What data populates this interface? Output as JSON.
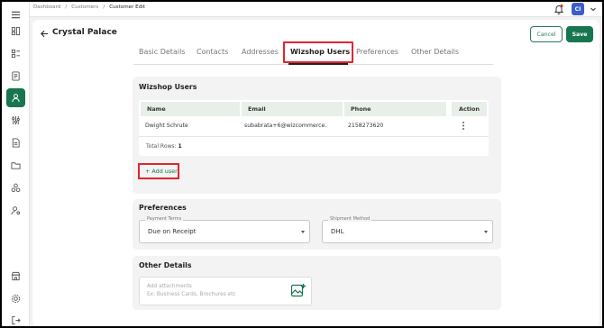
{
  "breadcrumb": {
    "items": [
      "Dashboard",
      "Customers"
    ],
    "current": "Customer Edit",
    "separator": "/"
  },
  "header": {
    "title": "Crystal Palace",
    "cancel_label": "Cancel",
    "save_label": "Save"
  },
  "user": {
    "initials": "CI"
  },
  "tabs": [
    {
      "label": "Basic Details",
      "active": false
    },
    {
      "label": "Contacts",
      "active": false
    },
    {
      "label": "Addresses",
      "active": false
    },
    {
      "label": "Wizshop Users",
      "active": true
    },
    {
      "label": "Preferences",
      "active": false
    },
    {
      "label": "Other Details",
      "active": false
    }
  ],
  "wizshop_users": {
    "title": "Wizshop Users",
    "columns": [
      "Name",
      "Email",
      "Phone",
      "Action"
    ],
    "rows": [
      {
        "name": "Dwight Schrute",
        "email": "subabrata+6@wizcommerce.",
        "phone": "2158273620"
      }
    ],
    "total_label": "Total Rows:",
    "total_value": "1",
    "add_user_label": "+ Add user"
  },
  "preferences": {
    "title": "Preferences",
    "payment_terms": {
      "label": "Payment Terms",
      "value": "Due on Receipt"
    },
    "shipment_method": {
      "label": "Shipment Method",
      "value": "DHL"
    }
  },
  "other_details": {
    "title": "Other Details",
    "attachments_title": "Add attachments",
    "attachments_hint": "Ex: Business Cards, Brochures etc"
  },
  "colors": {
    "brand": "#17764f",
    "highlight": "#e0262e",
    "avatar": "#3b5ec8"
  },
  "sidebar_icons": [
    "menu-icon",
    "dashboard-icon",
    "catalog-icon",
    "orders-icon",
    "customers-icon",
    "settings-sliders-icon",
    "documents-icon",
    "folder-icon",
    "integrations-icon",
    "user-settings-icon",
    "store-icon",
    "gear-icon",
    "logout-icon"
  ]
}
